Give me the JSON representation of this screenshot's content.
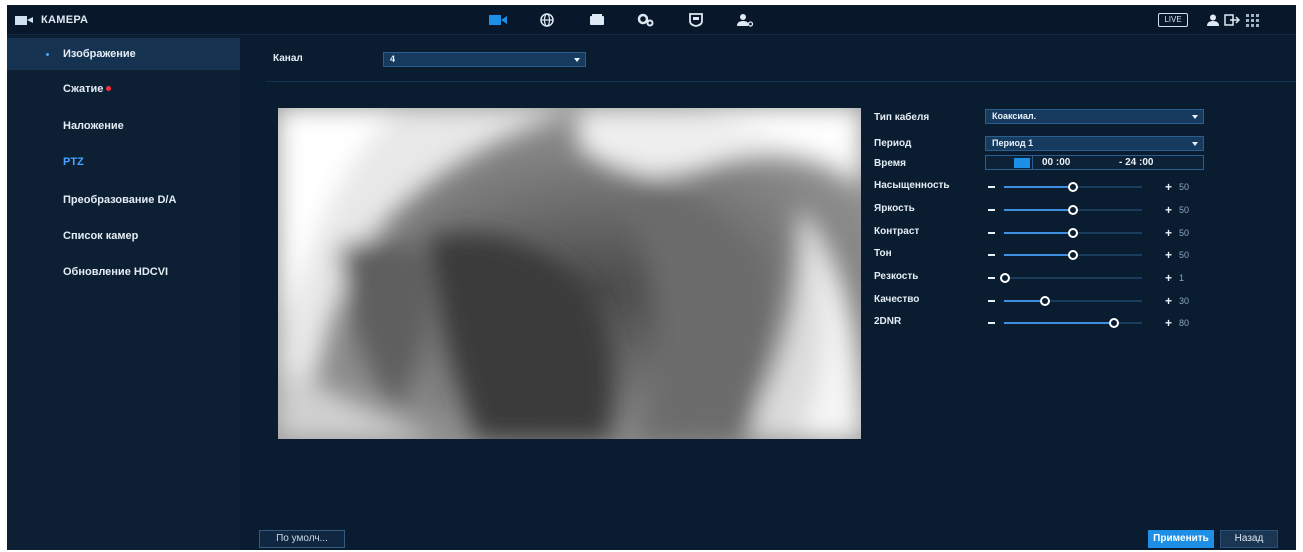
{
  "app": {
    "title": "КАМЕРА",
    "live_label": "LIVE"
  },
  "topnav": {
    "icons": [
      "camera-icon",
      "network-icon",
      "storage-icon",
      "system-settings-icon",
      "security-icon",
      "account-icon"
    ]
  },
  "sidebar": {
    "items": [
      {
        "label": "Изображение",
        "active": true
      },
      {
        "label": "Сжатие",
        "modified": true
      },
      {
        "label": "Наложение"
      },
      {
        "label": "PTZ"
      },
      {
        "label": "Преобразование D/A"
      },
      {
        "label": "Список камер"
      },
      {
        "label": "Обновление HDCVI"
      }
    ]
  },
  "channel": {
    "label": "Канал",
    "value": "4"
  },
  "settings": {
    "cable_type": {
      "label": "Тип кабеля",
      "value": "Коаксиал."
    },
    "period": {
      "label": "Период",
      "value": "Период 1"
    },
    "time": {
      "label": "Время",
      "start": "00 :00",
      "end": "- 24 :00"
    },
    "sliders": [
      {
        "label": "Насыщенность",
        "value": 50
      },
      {
        "label": "Яркость",
        "value": 50
      },
      {
        "label": "Контраст",
        "value": 50
      },
      {
        "label": "Тон",
        "value": 50
      },
      {
        "label": "Резкость",
        "value": 1
      },
      {
        "label": "Качество",
        "value": 30
      },
      {
        "label": "2DNR",
        "value": 80
      }
    ]
  },
  "buttons": {
    "default": "По умолч...",
    "apply": "Применить",
    "back": "Назад"
  },
  "colors": {
    "accent": "#1e8fe6",
    "background": "#0a1c2f",
    "sidebar": "#0c1f33"
  }
}
